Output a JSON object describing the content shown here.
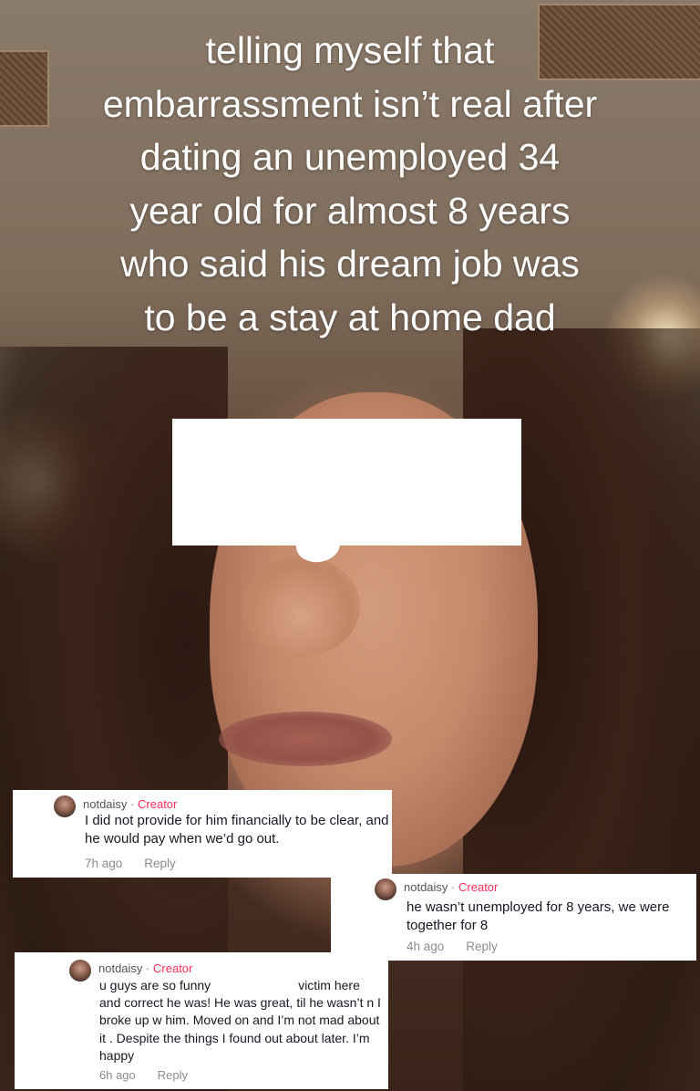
{
  "caption": {
    "lines": [
      "telling myself that",
      "embarrassment isn’t real after",
      "dating an unemployed 34",
      "year old for almost 8 years",
      "who said his dream job was",
      "to be a stay at home dad"
    ]
  },
  "comments": [
    {
      "username": "notdaisy",
      "creator_badge": "Creator",
      "separator": "·",
      "text": "I did not provide for him financially to be clear, and he would pay when we’d go out.",
      "time": "7h ago",
      "reply_label": "Reply"
    },
    {
      "username": "notdaisy",
      "creator_badge": "Creator",
      "separator": "·",
      "text": "he wasn’t unemployed for 8 years, we were together for 8",
      "time": "4h ago",
      "reply_label": "Reply"
    },
    {
      "username": "notdaisy",
      "creator_badge": "Creator",
      "separator": "·",
      "text_part1": "u guys are so funny",
      "text_part2": "victim here and correct he was! He was great, til he wasn’t n I broke up w him. Moved on and I’m not mad about it . Despite the things I found out about later. I’m happy",
      "time": "6h ago",
      "reply_label": "Reply"
    }
  ],
  "colors": {
    "creator": "#fe2c55",
    "meta": "#8a8b91",
    "text": "#161823",
    "redaction": "#ffffff"
  }
}
